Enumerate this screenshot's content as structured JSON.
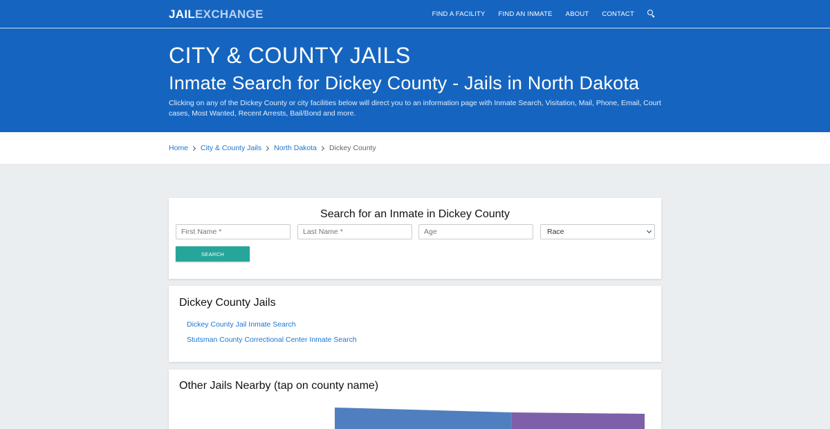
{
  "header": {
    "logo_part1": "JAIL",
    "logo_part2": "EXCHANGE",
    "nav": [
      "FIND A FACILITY",
      "FIND AN INMATE",
      "ABOUT",
      "CONTACT"
    ]
  },
  "hero": {
    "kicker": "CITY & COUNTY JAILS",
    "title": "Inmate Search for Dickey County - Jails in North Dakota",
    "description": "Clicking on any of the Dickey County or city facilities below will direct you to an information page with Inmate Search, Visitation, Mail, Phone, Email, Court cases, Most Wanted, Recent Arrests, Bail/Bond and more."
  },
  "breadcrumb": {
    "items": [
      "Home",
      "City & County Jails",
      "North Dakota"
    ],
    "current": "Dickey County"
  },
  "search": {
    "title": "Search for an Inmate in Dickey County",
    "first_name_placeholder": "First Name *",
    "last_name_placeholder": "Last Name *",
    "age_placeholder": "Age",
    "race_selected": "Race",
    "button": "SEARCH"
  },
  "jails": {
    "title": "Dickey County Jails",
    "links": [
      "Dickey County Jail Inmate Search",
      "Stutsman County Correctional Center Inmate Search"
    ]
  },
  "nearby": {
    "title": "Other Jails Nearby (tap on county name)"
  },
  "colors": {
    "brand_blue": "#1565c0",
    "link_blue": "#1976d2",
    "button_teal": "#26a69a",
    "map_blue": "#4f7fbe",
    "map_purple": "#7e60a8"
  }
}
